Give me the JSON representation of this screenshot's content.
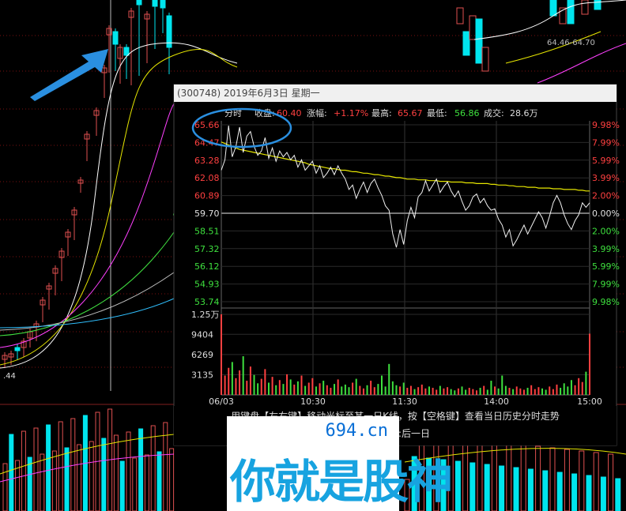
{
  "popup": {
    "title": "(300748) 2019年6月3日 星期一",
    "info": {
      "mode": "分时",
      "close_label": "收盘:",
      "close_value": "60.40",
      "change_label": "涨幅:",
      "change_value": "+1.17%",
      "high_label": "最高:",
      "high_value": "65.67",
      "low_label": "最低:",
      "low_value": "56.86",
      "volume_label": "成交:",
      "volume_value": "28.6万"
    },
    "footer_line1": "用键盘【左右键】移动光标至某一日K线，按【空格键】查看当日历史分时走势",
    "footer_line2": "方向键右:后一日"
  },
  "background": {
    "price_corner_label": "64.46-64.70",
    "left_low_label": ".44"
  },
  "watermark": {
    "url": "694.cn",
    "slogan": "你就是股神"
  },
  "colors": {
    "up": "#ff4040",
    "down": "#3ee03e",
    "neutral": "#e0e0e0",
    "avg_line": "#e6e600",
    "cyan_bar": "#00e5ee",
    "red_bar": "#e05050",
    "annotation_blue": "#2a8fe0"
  },
  "chart_data": {
    "type": "line",
    "x_ticks": [
      "06/03",
      "10:30",
      "11:30",
      "14:00",
      "15:00"
    ],
    "price_axis_left": [
      "65.66",
      "64.47",
      "63.28",
      "62.08",
      "60.89",
      "59.70",
      "58.51",
      "57.32",
      "56.12",
      "54.93",
      "53.74"
    ],
    "price_axis_right": [
      "9.98%",
      "7.99%",
      "5.99%",
      "3.99%",
      "2.00%",
      "0.00%",
      "2.00%",
      "3.99%",
      "5.99%",
      "7.99%",
      "9.98%"
    ],
    "volume_axis": [
      "1.25万",
      "9404",
      "6269",
      "3135"
    ],
    "ylim": [
      53.74,
      65.66
    ],
    "prev_close": 59.7,
    "price": [
      62.6,
      63.3,
      65.6,
      63.5,
      64.2,
      65.5,
      63.8,
      64.9,
      65.2,
      64.2,
      63.6,
      63.9,
      64.8,
      63.4,
      64.1,
      63.2,
      63.9,
      63.5,
      63.8,
      63.3,
      63.6,
      62.8,
      63.3,
      62.6,
      62.9,
      63.2,
      62.4,
      62.9,
      62.1,
      62.4,
      62.8,
      62.3,
      62.9,
      62.4,
      62.0,
      61.3,
      61.6,
      60.7,
      61.3,
      61.8,
      61.1,
      61.7,
      62.0,
      61.4,
      60.9,
      60.2,
      59.9,
      58.3,
      57.4,
      58.6,
      57.6,
      59.2,
      60.1,
      59.4,
      60.8,
      61.1,
      61.9,
      61.2,
      61.6,
      62.0,
      61.1,
      61.5,
      61.8,
      61.2,
      60.8,
      61.2,
      60.5,
      59.9,
      60.2,
      60.8,
      61.0,
      60.4,
      60.7,
      60.2,
      59.9,
      60.0,
      59.3,
      58.9,
      58.1,
      58.6,
      57.5,
      57.9,
      58.4,
      58.9,
      58.3,
      58.8,
      59.3,
      59.8,
      59.4,
      58.7,
      59.5,
      60.4,
      60.9,
      60.4,
      59.6,
      59.0,
      58.6,
      59.2,
      59.6,
      60.4,
      60.1,
      60.4
    ],
    "avg": [
      64.5,
      64.4,
      64.3,
      64.2,
      64.1,
      64.0,
      63.95,
      63.9,
      63.85,
      63.8,
      63.75,
      63.7,
      63.65,
      63.6,
      63.55,
      63.5,
      63.45,
      63.4,
      63.35,
      63.3,
      63.25,
      63.2,
      63.15,
      63.1,
      63.0,
      62.95,
      62.9,
      62.85,
      62.8,
      62.75,
      62.7,
      62.7,
      62.65,
      62.6,
      62.6,
      62.55,
      62.5,
      62.5,
      62.45,
      62.4,
      62.4,
      62.35,
      62.3,
      62.3,
      62.25,
      62.2,
      62.2,
      62.15,
      62.1,
      62.1,
      62.05,
      62.0,
      62.0,
      62.0,
      61.95,
      61.95,
      61.95,
      61.9,
      61.9,
      61.9,
      61.85,
      61.85,
      61.85,
      61.8,
      61.8,
      61.8,
      61.8,
      61.75,
      61.75,
      61.75,
      61.7,
      61.7,
      61.7,
      61.7,
      61.65,
      61.65,
      61.6,
      61.6,
      61.6,
      61.55,
      61.55,
      61.5,
      61.5,
      61.5,
      61.45,
      61.45,
      61.45,
      61.4,
      61.4,
      61.4,
      61.4,
      61.35,
      61.35,
      61.35,
      61.3,
      61.3,
      61.3,
      61.3,
      61.25,
      61.25,
      61.2,
      61.2
    ],
    "volume": [
      12500,
      3000,
      4200,
      5100,
      2600,
      3800,
      6000,
      2200,
      4400,
      3100,
      1800,
      2500,
      4000,
      1900,
      2800,
      1500,
      2300,
      1700,
      3200,
      2400,
      1600,
      2100,
      3000,
      1400,
      1900,
      2600,
      1300,
      1800,
      2200,
      1500,
      1100,
      1700,
      2400,
      1300,
      1600,
      1200,
      1900,
      2500,
      1400,
      1000,
      1500,
      2200,
      1200,
      1700,
      3000,
      1300,
      4800,
      2100,
      1500,
      1300,
      1900,
      1100,
      1400,
      900,
      1200,
      1600,
      1000,
      1300,
      1100,
      800,
      1400,
      1000,
      1200,
      900,
      700,
      1000,
      1300,
      800,
      1100,
      900,
      700,
      1100,
      1400,
      800,
      2200,
      1300,
      1000,
      3000,
      1400,
      1100,
      900,
      1300,
      1000,
      800,
      1100,
      1500,
      900,
      1200,
      1000,
      800,
      1300,
      900,
      1600,
      1100,
      1800,
      1300,
      2300,
      1500,
      2600,
      2000,
      3600,
      9500
    ]
  }
}
